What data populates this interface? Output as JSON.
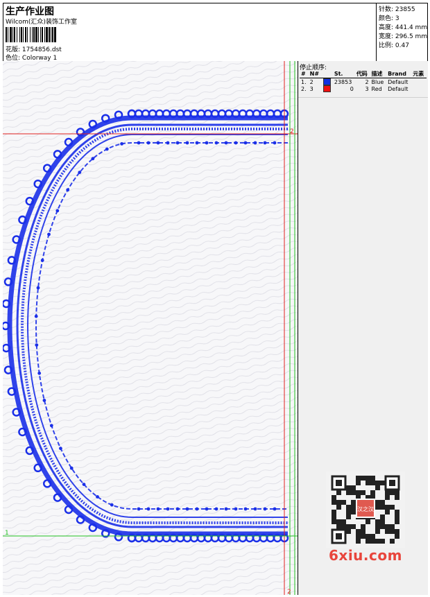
{
  "header": {
    "title": "生产作业图",
    "company": "Wilcom(汇众)装饰工作室",
    "file_label": "花版:",
    "file_name": "1754856.dst",
    "color_label": "色位:",
    "colorway": "Colorway 1"
  },
  "stats": [
    {
      "label": "针数:",
      "value": "23855"
    },
    {
      "label": "颜色:",
      "value": "3"
    },
    {
      "label": "高度:",
      "value": "441.4 mm"
    },
    {
      "label": "宽度:",
      "value": "296.5 mm"
    },
    {
      "label": "比例:",
      "value": "0.47"
    }
  ],
  "stop_sequence": {
    "title": "停止顺序:",
    "headers": [
      "#",
      "N#",
      "",
      "St.",
      "代码",
      "描述",
      "Brand",
      "元素"
    ],
    "rows": [
      {
        "index": "1.",
        "needle": "2",
        "color": "#1030e0",
        "stitches": "23853",
        "code": "2",
        "desc": "Blue",
        "brand": "Default"
      },
      {
        "index": "2.",
        "needle": "3",
        "color": "#ee1010",
        "stitches": "0",
        "code": "3",
        "desc": "Red",
        "brand": "Default"
      }
    ]
  },
  "guides": {
    "red_label_top": "2",
    "red_label_bottom": "2",
    "green_label": "1",
    "red_color": "#e02020",
    "green_color": "#20c020"
  },
  "design": {
    "stitch_color": "#1a2fe8"
  },
  "watermark": {
    "text": "6xiu.com",
    "qr_center": "汉之汉"
  }
}
